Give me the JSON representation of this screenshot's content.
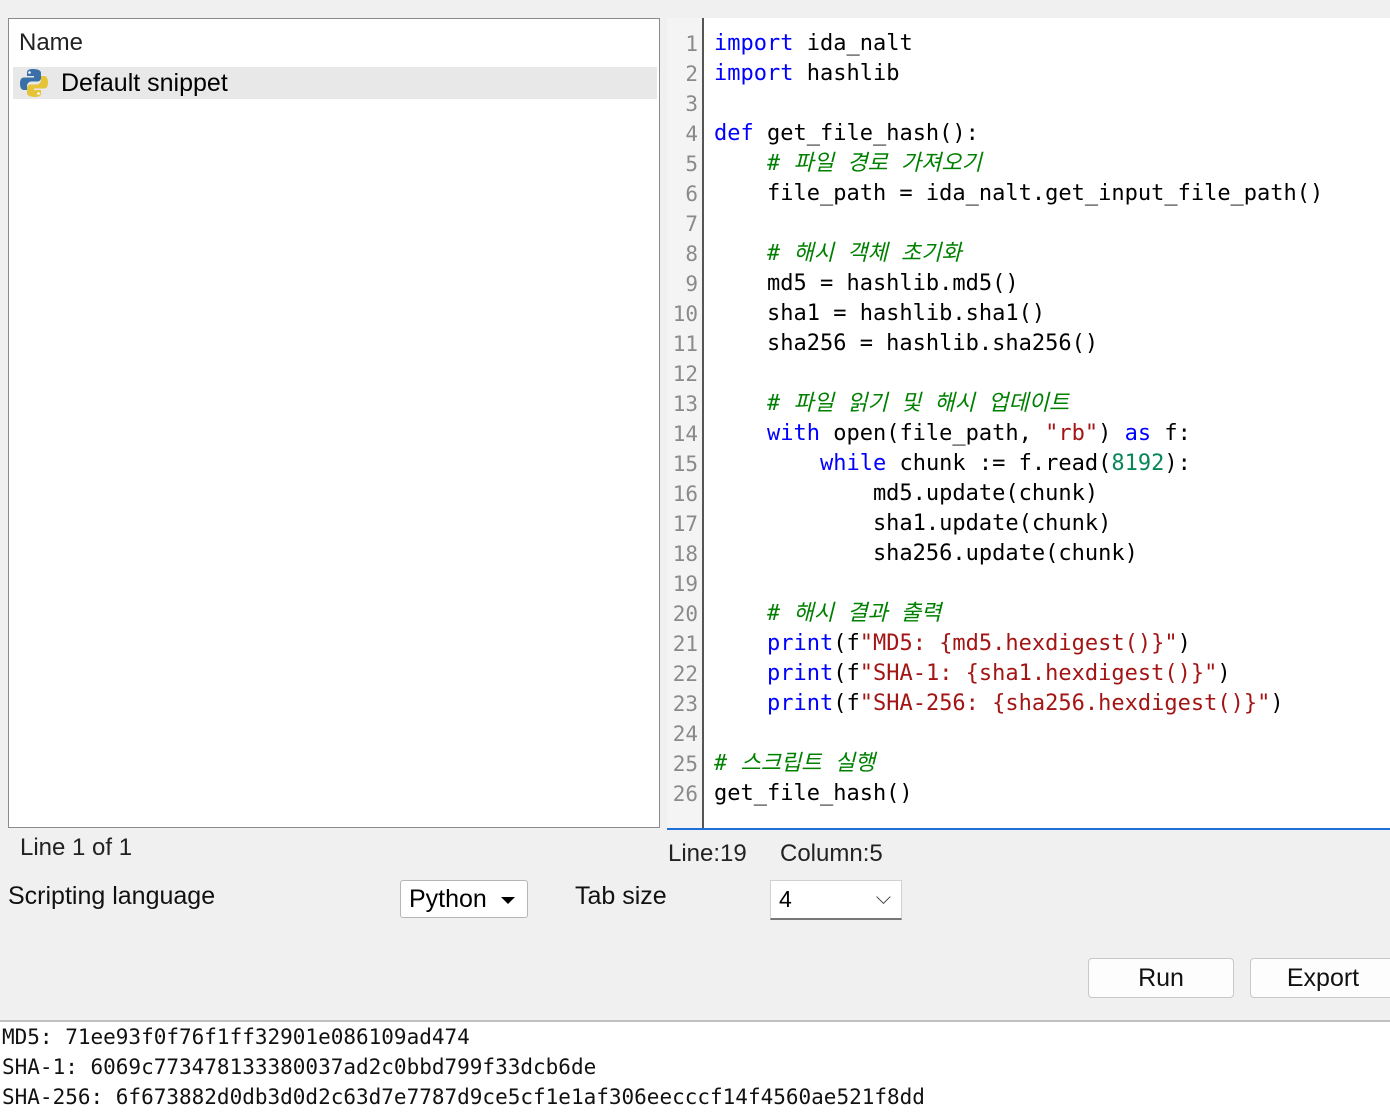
{
  "snippet_list": {
    "header": "Name",
    "items": [
      {
        "label": "Default snippet",
        "icon": "python-icon"
      }
    ],
    "status": "Line 1 of 1"
  },
  "editor": {
    "line_numbers": [
      "1",
      "2",
      "3",
      "4",
      "5",
      "6",
      "7",
      "8",
      "9",
      "10",
      "11",
      "12",
      "13",
      "14",
      "15",
      "16",
      "17",
      "18",
      "19",
      "20",
      "21",
      "22",
      "23",
      "24",
      "25",
      "26"
    ],
    "status_line": "Line:19",
    "status_column": "Column:5"
  },
  "controls": {
    "scripting_language_label": "Scripting language",
    "scripting_language_value": "Python",
    "tab_size_label": "Tab size",
    "tab_size_value": "4",
    "run_label": "Run",
    "export_label": "Export"
  },
  "output": {
    "lines": [
      "MD5: 71ee93f0f76f1ff32901e086109ad474",
      "SHA-1: 6069c773478133380037ad2c0bbd799f33dcb6de",
      "SHA-256: 6f673882d0db3d0d2c63d7e7787d9ce5cf1e1af306eecccf14f4560ae521f8dd"
    ]
  },
  "colors": {
    "keyword": "#0000ff",
    "comment": "#008000",
    "string": "#a31515",
    "number": "#098658",
    "accent": "#1e6fd9"
  }
}
